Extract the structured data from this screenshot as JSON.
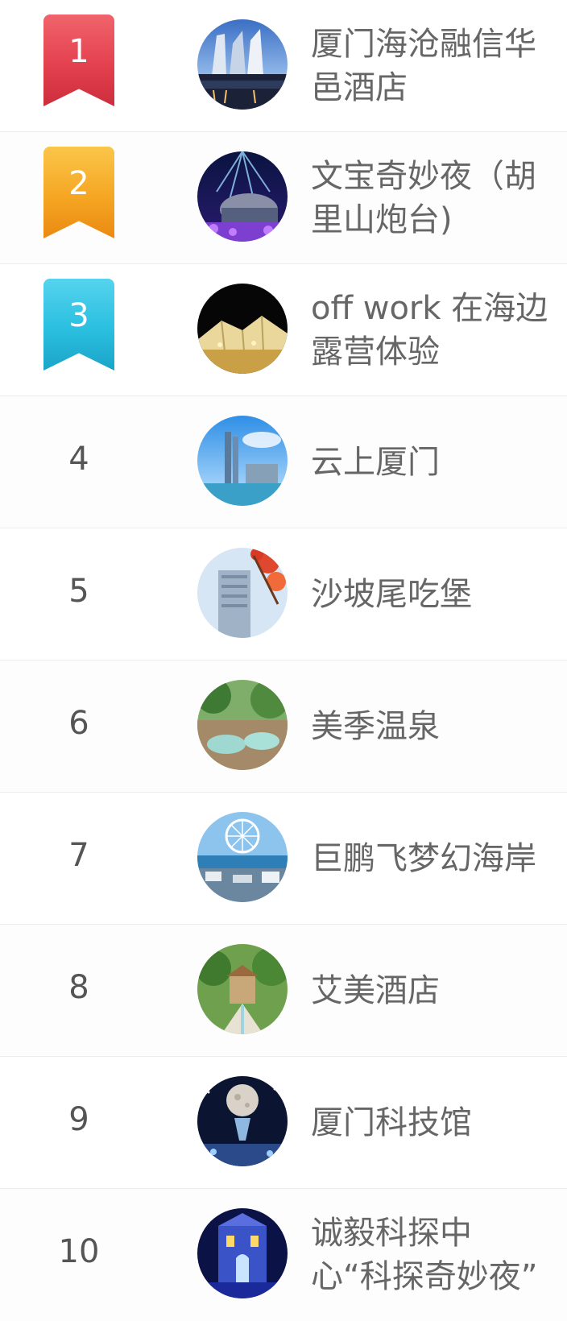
{
  "ranking_list": {
    "items": [
      {
        "rank": "1",
        "name": "厦门海沧融信华邑酒店",
        "badge": "ribbon",
        "color": "#e4414f",
        "icon": "hotel-skyline-thumbnail"
      },
      {
        "rank": "2",
        "name": "文宝奇妙夜（胡里山炮台)",
        "badge": "ribbon",
        "color": "#f5a623",
        "icon": "night-show-thumbnail"
      },
      {
        "rank": "3",
        "name": "off work 在海边露营体验",
        "badge": "ribbon",
        "color": "#2bbfe0",
        "icon": "camping-tent-thumbnail"
      },
      {
        "rank": "4",
        "name": "云上厦门",
        "badge": "plain",
        "icon": "tower-skyline-thumbnail"
      },
      {
        "rank": "5",
        "name": "沙坡尾吃堡",
        "badge": "plain",
        "icon": "building-flowers-thumbnail"
      },
      {
        "rank": "6",
        "name": "美季温泉",
        "badge": "plain",
        "icon": "hot-spring-thumbnail"
      },
      {
        "rank": "7",
        "name": "巨鹏飞梦幻海岸",
        "badge": "plain",
        "icon": "ferris-wheel-thumbnail"
      },
      {
        "rank": "8",
        "name": "艾美酒店",
        "badge": "plain",
        "icon": "resort-garden-thumbnail"
      },
      {
        "rank": "9",
        "name": "厦门科技馆",
        "badge": "plain",
        "icon": "science-museum-thumbnail"
      },
      {
        "rank": "10",
        "name": "诚毅科探中心“科探奇妙夜”",
        "badge": "plain",
        "icon": "illuminated-building-thumbnail"
      }
    ]
  }
}
